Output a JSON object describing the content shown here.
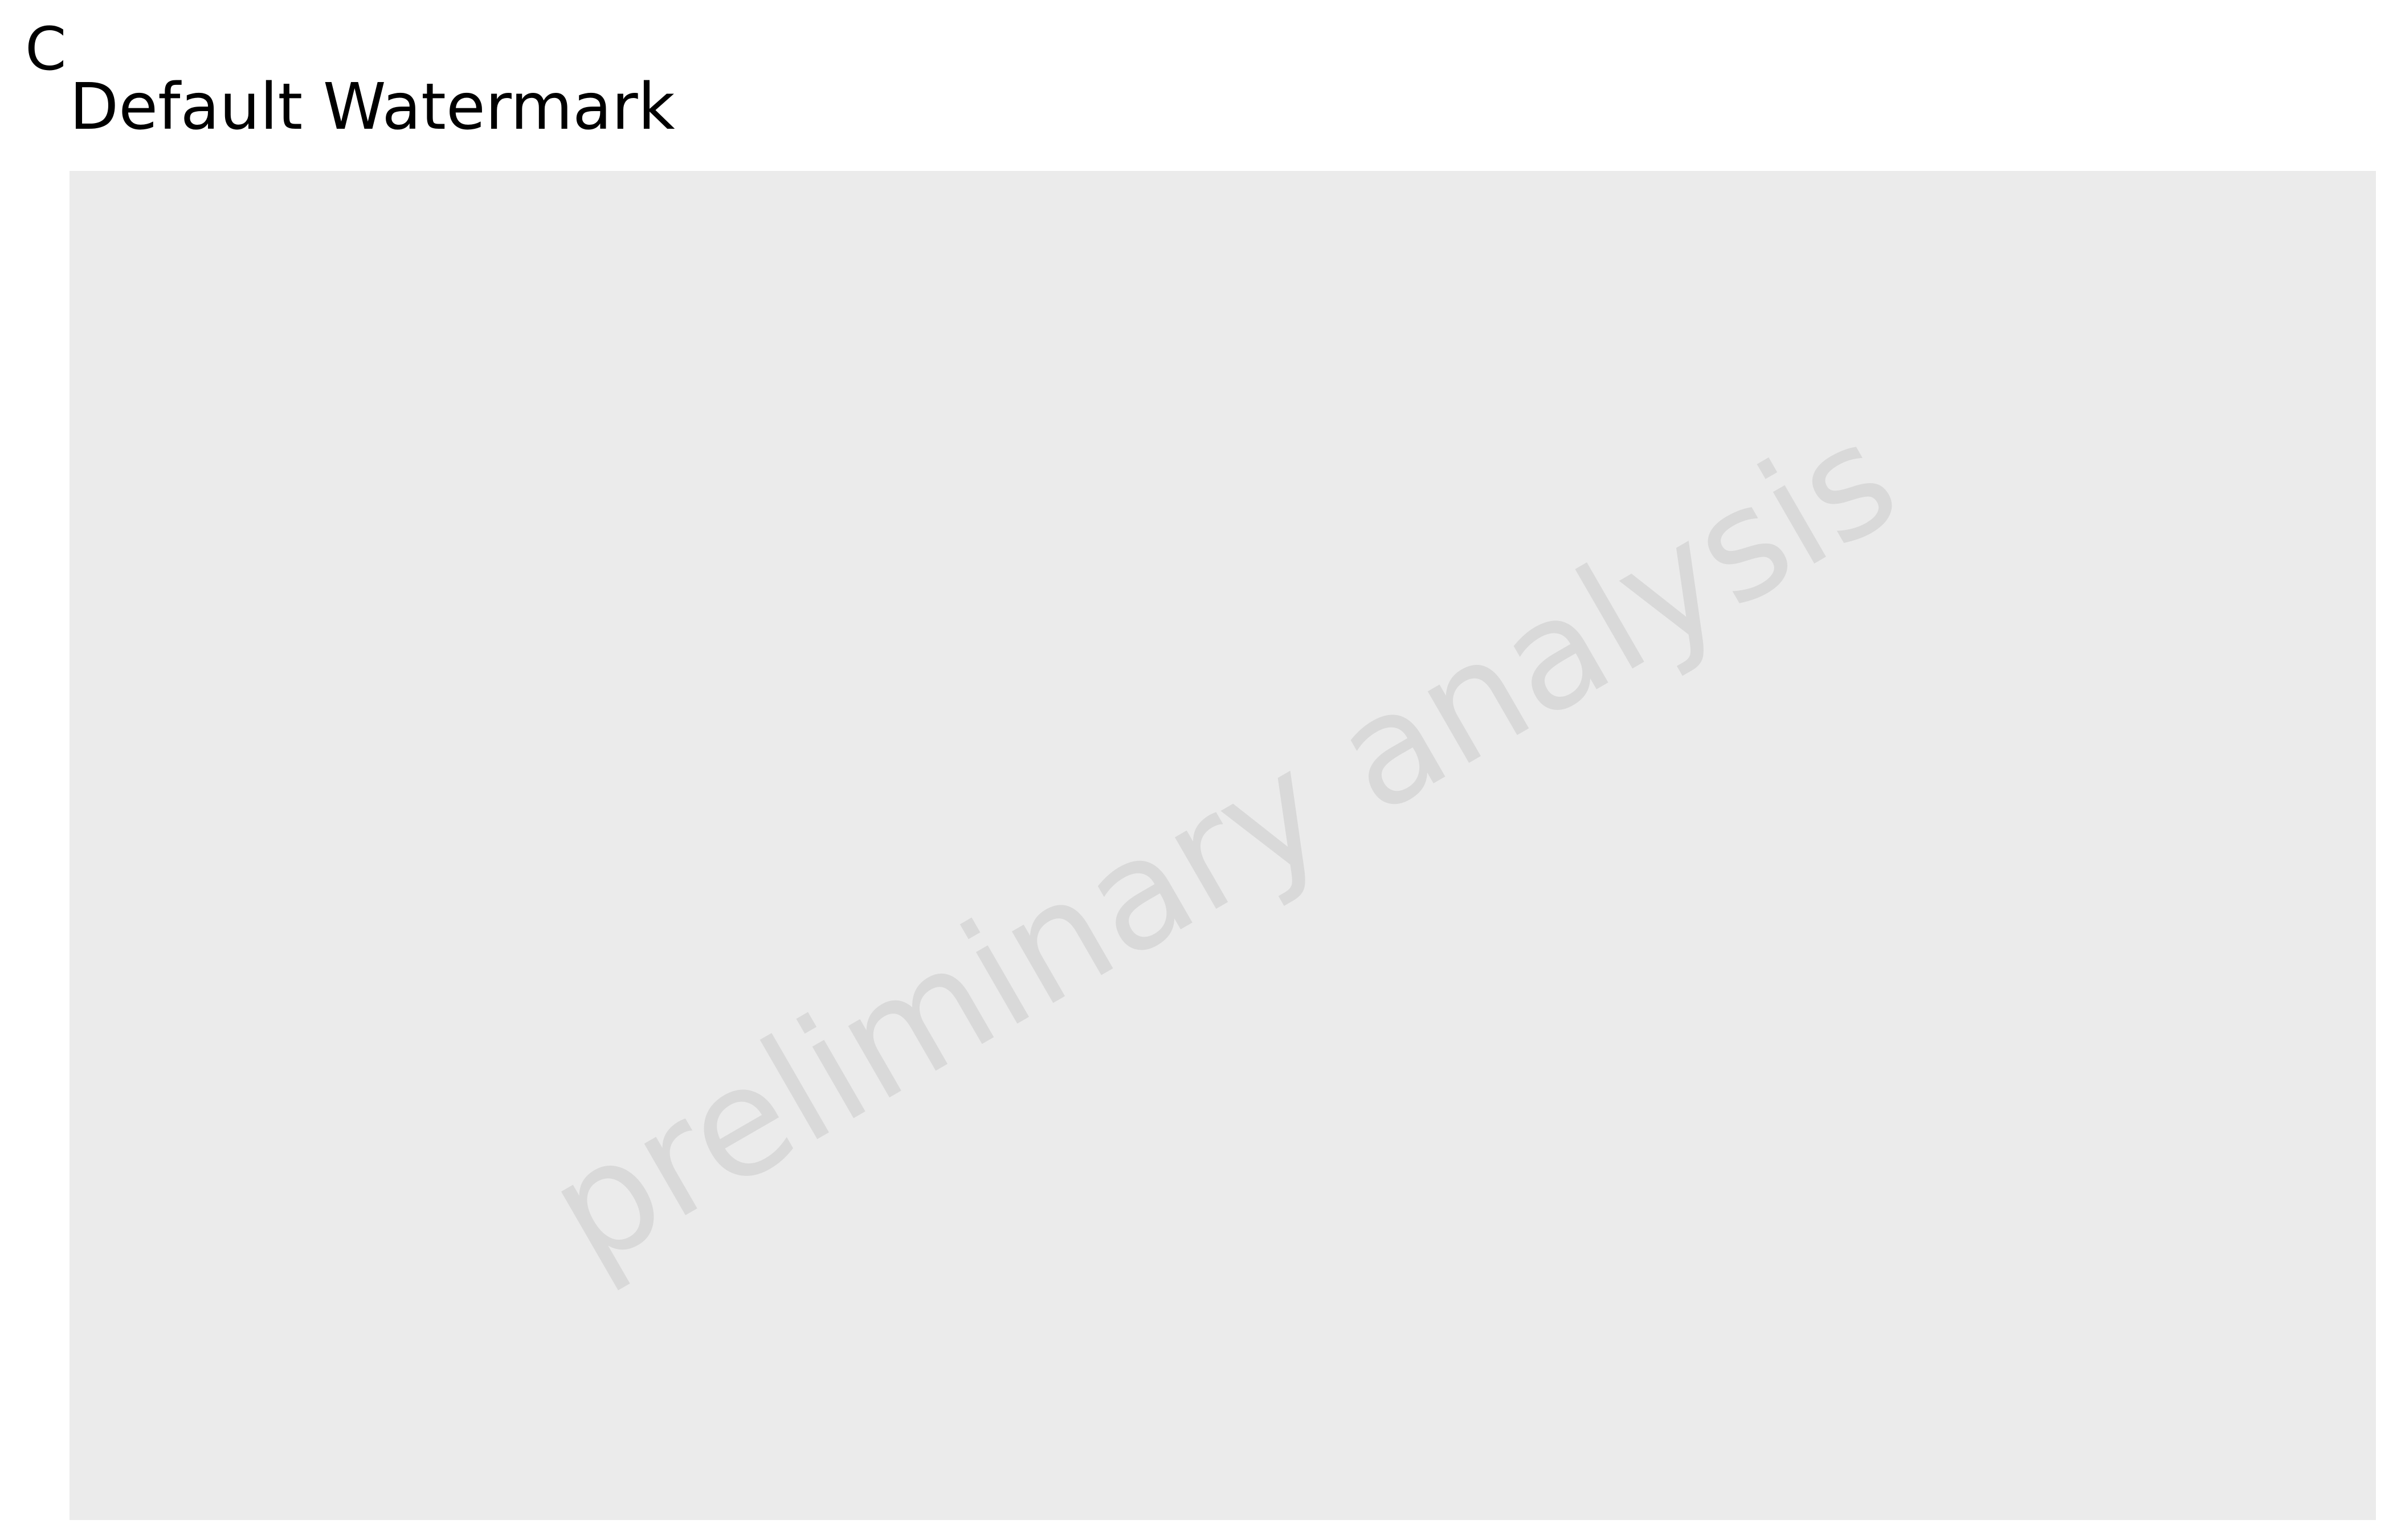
{
  "panel_tag": "C",
  "chart_data": {
    "type": "scatter",
    "title": "Default Watermark",
    "xlabel": "",
    "ylabel": "",
    "series": [],
    "grid": false,
    "watermark": {
      "text": "preliminary analysis",
      "color": "#d9d9d9",
      "angle_degrees": 30
    },
    "panel_background": "#ebebeb"
  }
}
